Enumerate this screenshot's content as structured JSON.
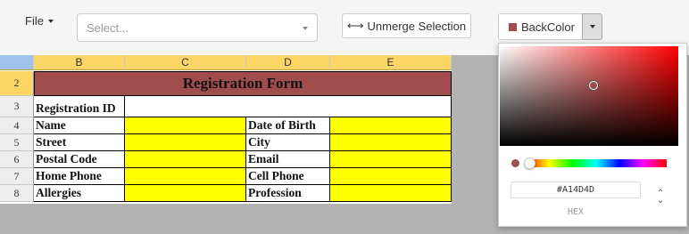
{
  "toolbar": {
    "file_label": "File",
    "select_placeholder": "Select...",
    "unmerge_label": "Unmerge Selection",
    "backcolor_label": "BackColor"
  },
  "sheet": {
    "columns": [
      "B",
      "C",
      "D",
      "E"
    ],
    "rows": [
      "2",
      "3",
      "4",
      "5",
      "6",
      "7",
      "8"
    ],
    "title": "Registration Form",
    "registration_id_label": "Registration ID",
    "left_labels": [
      "Name",
      "Street",
      "Postal Code",
      "Home Phone",
      "Allergies"
    ],
    "right_labels": [
      "Date of Birth",
      "City",
      "Email",
      "Cell Phone",
      "Profession"
    ]
  },
  "picker": {
    "hex_value": "#A14D4D",
    "mode_label": "HEX"
  },
  "colors": {
    "title_fill": "#a14d4d",
    "input_fill": "#ffff00",
    "header_fill": "#fbd666",
    "selected_color": "#a14d4d"
  }
}
